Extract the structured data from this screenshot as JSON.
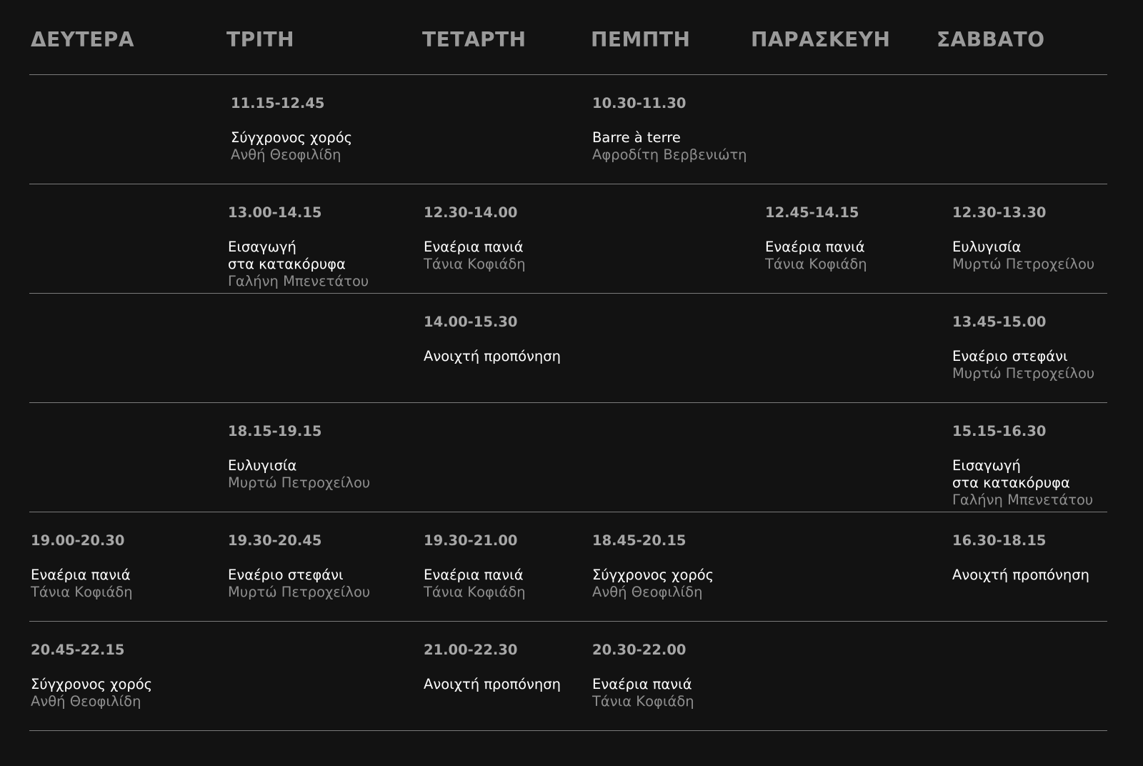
{
  "days": [
    "ΔΕΥΤΕΡΑ",
    "ΤΡΙΤΗ",
    "ΤΕΤΑΡΤΗ",
    "ΠΕΜΠΤΗ",
    "ΠΑΡΑΣΚΕΥΗ",
    "ΣΑΒΒΑΤΟ"
  ],
  "rows": [
    [
      null,
      {
        "time": "11.15-12.45",
        "class": "Σύγχρονος χορός",
        "teacher": "Ανθή Θεοφιλίδη"
      },
      null,
      {
        "time": "10.30-11.30",
        "class": "Barre à terre",
        "teacher": "Αφροδίτη Βερβενιώτη"
      },
      null,
      null
    ],
    [
      null,
      {
        "time": "13.00-14.15",
        "class": "Εισαγωγή\nστα κατακόρυφα",
        "teacher": "Γαλήνη Μπενετάτου"
      },
      {
        "time": "12.30-14.00",
        "class": "Εναέρια πανιά",
        "teacher": "Τάνια Κοφιάδη"
      },
      null,
      {
        "time": "12.45-14.15",
        "class": "Εναέρια πανιά",
        "teacher": "Τάνια Κοφιάδη"
      },
      {
        "time": "12.30-13.30",
        "class": "Ευλυγισία",
        "teacher": "Μυρτώ Πετροχείλου"
      }
    ],
    [
      null,
      null,
      {
        "time": "14.00-15.30",
        "class": "Ανοιχτή προπόνηση",
        "teacher": ""
      },
      null,
      null,
      {
        "time": "13.45-15.00",
        "class": "Εναέριο στεφάνι",
        "teacher": "Μυρτώ Πετροχείλου"
      }
    ],
    [
      null,
      {
        "time": "18.15-19.15",
        "class": "Ευλυγισία",
        "teacher": "Μυρτώ Πετροχείλου"
      },
      null,
      null,
      null,
      {
        "time": "15.15-16.30",
        "class": "Εισαγωγή\nστα κατακόρυφα",
        "teacher": "Γαλήνη Μπενετάτου"
      }
    ],
    [
      {
        "time": "19.00-20.30",
        "class": "Εναέρια πανιά",
        "teacher": "Τάνια Κοφιάδη"
      },
      {
        "time": "19.30-20.45",
        "class": "Εναέριο στεφάνι",
        "teacher": "Μυρτώ Πετροχείλου"
      },
      {
        "time": "19.30-21.00",
        "class": "Εναέρια πανιά",
        "teacher": "Τάνια Κοφιάδη"
      },
      {
        "time": "18.45-20.15",
        "class": "Σύγχρονος χορός",
        "teacher": "Ανθή Θεοφιλίδη"
      },
      null,
      {
        "time": "16.30-18.15",
        "class": "Ανοιχτή προπόνηση",
        "teacher": ""
      }
    ],
    [
      {
        "time": "20.45-22.15",
        "class": "Σύγχρονος χορός",
        "teacher": "Ανθή Θεοφιλίδη"
      },
      null,
      {
        "time": "21.00-22.30",
        "class": "Ανοιχτή προπόνηση",
        "teacher": ""
      },
      {
        "time": "20.30-22.00",
        "class": "Εναέρια πανιά",
        "teacher": "Τάνια Κοφιάδη"
      },
      null,
      null
    ]
  ]
}
